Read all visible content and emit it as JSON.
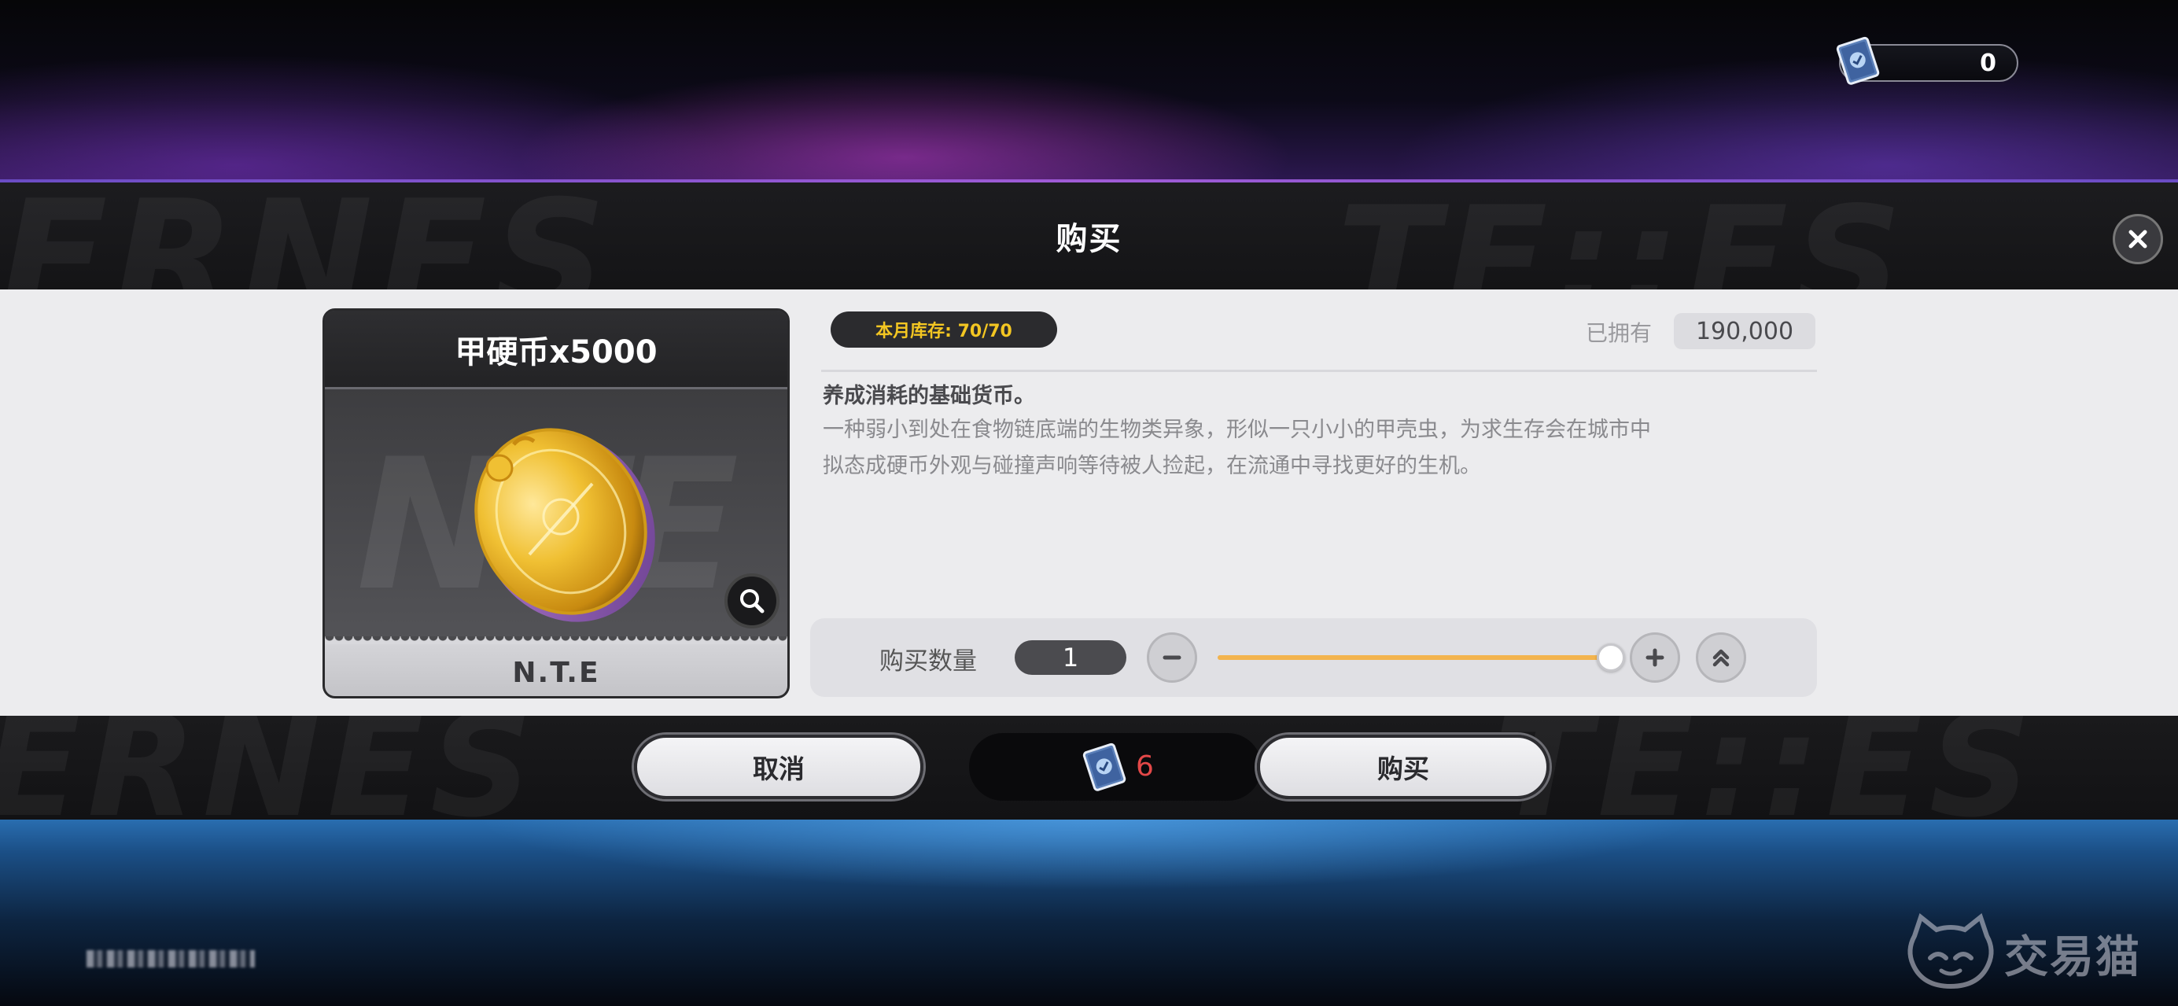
{
  "currency_top": {
    "icon": "book-currency-icon",
    "value": "0"
  },
  "dialog": {
    "title": "购买",
    "close_icon": "close-icon"
  },
  "item": {
    "name": "甲硬币x5000",
    "brand": "N.T.E",
    "image": "gold-beetle-coin",
    "zoom_icon": "magnifier-icon"
  },
  "stock": {
    "label": "本月库存: 70/70"
  },
  "owned": {
    "label": "已拥有",
    "value": "190,000"
  },
  "description": {
    "title": "养成消耗的基础货币。",
    "lines": [
      "一种弱小到处在食物链底端的生物类异象，形似一只小小的甲壳虫，为求生存会在城市中",
      "拟态成硬币外观与碰撞声响等待被人捡起，在流通中寻找更好的生机。"
    ]
  },
  "quantity": {
    "label": "购买数量",
    "value": "1",
    "slider_fraction": 1.0,
    "minus_icon": "minus-icon",
    "plus_icon": "plus-icon",
    "max_icon": "double-chevron-up-icon"
  },
  "footer": {
    "cancel_label": "取消",
    "buy_label": "购买",
    "price_icon": "book-currency-icon",
    "price_value": "6"
  },
  "watermark": {
    "text": "交易猫"
  },
  "colors": {
    "accent_yellow": "#f3c622",
    "price_red": "#e34848",
    "slider_orange": "#f3b44e"
  }
}
